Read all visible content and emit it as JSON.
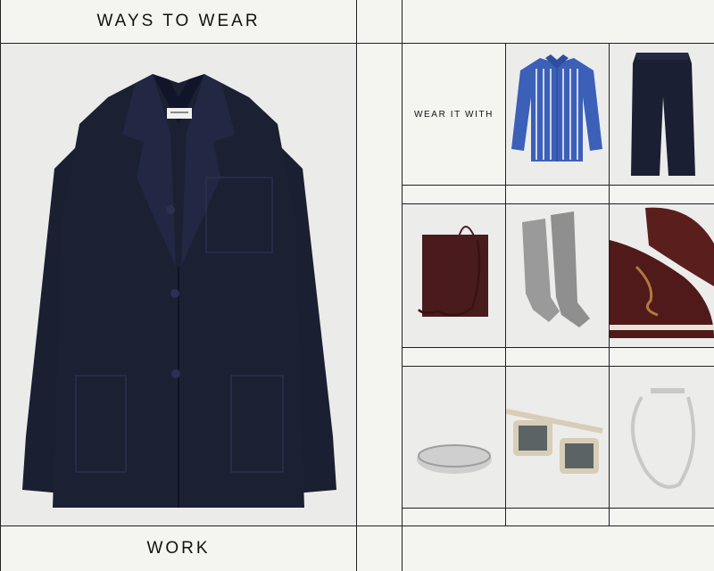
{
  "header": {
    "title": "WAYS TO WEAR"
  },
  "footer": {
    "title": "WORK"
  },
  "grid": {
    "label": "WEAR IT WITH"
  },
  "hero": {
    "item": "navy-blazer"
  },
  "items": [
    "blue-striped-shirt",
    "navy-trousers",
    "burgundy-crossbody-bag",
    "grey-ribbed-socks",
    "burgundy-boat-shoes",
    "silver-textured-ring",
    "clear-frame-sunglasses",
    "silver-chain-necklace"
  ],
  "colors": {
    "background": "#f4f4f1",
    "rule": "#222222",
    "navy": "#1b2033",
    "burgundy": "#4a1b1c",
    "shirt_blue": "#3c5fb8",
    "sock_grey": "#9a9a9a",
    "silver": "#cfcfcf"
  }
}
